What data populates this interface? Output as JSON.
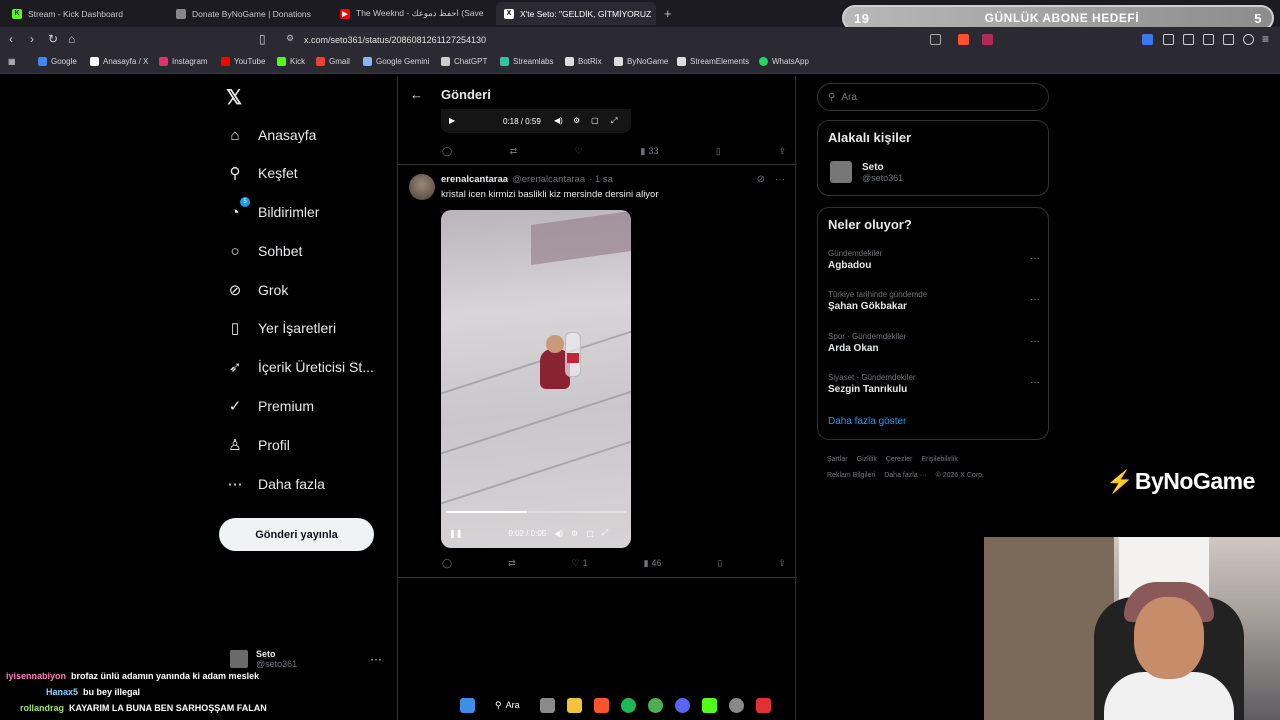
{
  "browser": {
    "tabs": [
      {
        "title": "Stream - Kick Dashboard",
        "color": "#53fc18",
        "glyph": "K"
      },
      {
        "title": "Donate ByNoGame | Donations",
        "color": "#888888",
        "glyph": "●"
      },
      {
        "title": "The Weeknd - احفظ دموعك (Save",
        "color": "#ff0000",
        "glyph": "▶"
      },
      {
        "title": "X'te Seto: \"GELDİK, GİTMİYORUZ",
        "color": "#ffffff",
        "glyph": "X"
      }
    ],
    "url": "x.com/seto361/status/2086081261127254130",
    "bookmarks": [
      {
        "label": "Google",
        "color": "#4285f4"
      },
      {
        "label": "Anasayfa / X",
        "color": "#ffffff"
      },
      {
        "label": "Instagram",
        "color": "#e1306c"
      },
      {
        "label": "YouTube",
        "color": "#ff0000"
      },
      {
        "label": "Kick",
        "color": "#53fc18"
      },
      {
        "label": "Gmail",
        "color": "#ea4335"
      },
      {
        "label": "Google Gemini",
        "color": "#8ab4f8"
      },
      {
        "label": "ChatGPT",
        "color": "#cccccc"
      },
      {
        "label": "Streamlabs",
        "color": "#31c3a2"
      },
      {
        "label": "BotRix",
        "color": "#dddddd"
      },
      {
        "label": "ByNoGame",
        "color": "#dddddd"
      },
      {
        "label": "StreamElements",
        "color": "#dddddd"
      },
      {
        "label": "WhatsApp",
        "color": "#25d366"
      }
    ]
  },
  "goal": {
    "left": "19",
    "label": "GÜNLÜK ABONE HEDEFİ",
    "right": "5"
  },
  "nav": {
    "items": [
      {
        "label": "Anasayfa",
        "icon": "home-icon",
        "glyph": "⌂"
      },
      {
        "label": "Keşfet",
        "icon": "search-icon",
        "glyph": "⚲"
      },
      {
        "label": "Bildirimler",
        "icon": "bell-icon",
        "glyph": "🔔︎"
      },
      {
        "label": "Sohbet",
        "icon": "chat-icon",
        "glyph": "○"
      },
      {
        "label": "Grok",
        "icon": "grok-icon",
        "glyph": "⊘"
      },
      {
        "label": "Yer İşaretleri",
        "icon": "bookmark-icon",
        "glyph": "▯"
      },
      {
        "label": "İçerik Üreticisi St...",
        "icon": "rocket-icon",
        "glyph": "➶"
      },
      {
        "label": "Premium",
        "icon": "verified-icon",
        "glyph": "✓"
      },
      {
        "label": "Profil",
        "icon": "profile-icon",
        "glyph": "♙"
      },
      {
        "label": "Daha fazla",
        "icon": "more-icon",
        "glyph": "⋯"
      }
    ],
    "notif_badge": "5",
    "post_button": "Gönderi yayınla",
    "account": {
      "name": "Seto",
      "handle": "@seto361"
    }
  },
  "center": {
    "title": "Gönderi",
    "prev_video_time": "0:18 / 0:59",
    "prev_views": "33",
    "tweet": {
      "name": "erenalcantaraa",
      "handle": "@erenalcantaraa",
      "time": "· 1 sa",
      "text": "kristal icen kirmizi baslikli kiz mersinde dersini aliyor",
      "video_time": "0:02 / 0:05",
      "video_progress": 0.45,
      "likes": "1",
      "views": "46"
    }
  },
  "right": {
    "search_placeholder": "Ara",
    "related_title": "Alakalı kişiler",
    "related_person": {
      "name": "Seto",
      "handle": "@seto361"
    },
    "trends_title": "Neler oluyor?",
    "trends": [
      {
        "category": "Gündemdekiler",
        "title": "Agbadou"
      },
      {
        "category": "Türkiye tarihinde gündemde",
        "title": "Şahan Gökbakar"
      },
      {
        "category": "Spor · Gündemdekiler",
        "title": "Arda Okan"
      },
      {
        "category": "Siyaset · Gündemdekiler",
        "title": "Sezgin Tanrıkulu"
      }
    ],
    "show_more": "Daha fazla göster",
    "footer": [
      "Şartlar",
      "Gizlilik",
      "Çerezler",
      "Erişilebilirlik",
      "Reklam Bilgileri",
      "Daha fazla ···",
      "© 2026 X Corp."
    ]
  },
  "overlay": {
    "brand": "ByNoGame",
    "chat": [
      {
        "user": "iyisennabiyon",
        "msg": "brofaz ünlü adamın yanında ki adam meslek",
        "color": "#ff7dbd"
      },
      {
        "user": "Hanax5",
        "msg": "bu bey illegal",
        "color": "#7fd3ff"
      },
      {
        "user": "rollandrag",
        "msg": "KAYARIM LA BUNA BEN SARHOŞŞAM FALAN",
        "color": "#9be37a"
      }
    ],
    "taskbar_search": "Ara"
  },
  "colors": {
    "accent": "#1d9bf0",
    "bg": "#000000",
    "border": "#2f3336",
    "muted": "#71767b"
  }
}
